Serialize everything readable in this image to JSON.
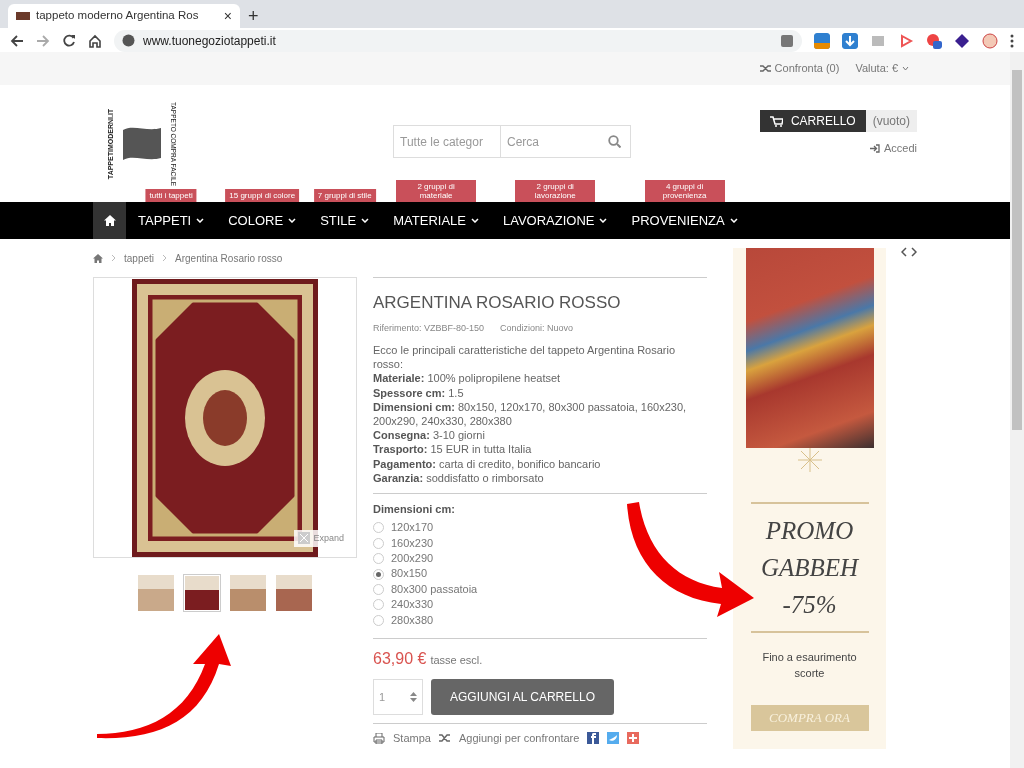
{
  "browser": {
    "tab_title": "tappeto moderno Argentina Ros",
    "tab_close": "×",
    "new_tab": "+",
    "url": "www.tuonegoziotappeti.it"
  },
  "top_bar": {
    "compare": "Confronta (0)",
    "currency": "Valuta: €"
  },
  "header": {
    "logo_text_top": "TAPPETIMODERNI.IT",
    "logo_text_side": "TAPPETO COMPRA FACILE",
    "category_select": "Tutte le categor",
    "search_placeholder": "Cerca",
    "cart_label": "CARRELLO",
    "cart_status": "(vuoto)",
    "login": "Accedi"
  },
  "menu": [
    {
      "label": "TAPPETI",
      "badge": "tutti i tappeti"
    },
    {
      "label": "COLORE",
      "badge": "15 gruppi di colore"
    },
    {
      "label": "STILE",
      "badge": "7 gruppi di stile"
    },
    {
      "label": "MATERIALE",
      "badge": "2 gruppi di materiale"
    },
    {
      "label": "LAVORAZIONE",
      "badge": "2 gruppi di lavorazione"
    },
    {
      "label": "PROVENIENZA",
      "badge": "4 gruppi di provenienza"
    }
  ],
  "breadcrumb": [
    "tappeti",
    "Argentina Rosario rosso"
  ],
  "gallery": {
    "expand": "Expand",
    "thumbnails": [
      {
        "selected": false
      },
      {
        "selected": true
      },
      {
        "selected": false
      },
      {
        "selected": false
      }
    ]
  },
  "product": {
    "title": "ARGENTINA ROSARIO ROSSO",
    "reference": "Riferimento: VZBBF-80-150",
    "condition": "Condizioni: Nuovo",
    "description": [
      "Ecco le principali caratteristiche del tappeto Argentina Rosario rosso:",
      "**Materiale:** 100% polipropilene heatset",
      "**Spessore cm:** 1.5",
      "**Dimensioni cm:** 80x150, 120x170, 80x300 passatoia, 160x230, 200x290, 240x330, 280x380",
      "**Consegna:** 3-10 giorni",
      "**Trasporto:** 15 EUR in tutta Italia",
      "**Pagamento:** carta di credito, bonifico bancario",
      "**Garanzia:** soddisfatto o rimborsato"
    ],
    "size_label": "Dimensioni cm:",
    "sizes": [
      {
        "label": "120x170",
        "selected": false
      },
      {
        "label": "160x230",
        "selected": false
      },
      {
        "label": "200x290",
        "selected": false
      },
      {
        "label": "80x150",
        "selected": true
      },
      {
        "label": "80x300 passatoia",
        "selected": false
      },
      {
        "label": "240x330",
        "selected": false
      },
      {
        "label": "280x380",
        "selected": false
      }
    ],
    "price": "63,90 €",
    "tax_note": "tasse escl.",
    "quantity": "1",
    "add_to_cart": "AGGIUNGI AL CARRELLO",
    "print": "Stampa",
    "compare": "Aggiungi per confrontare"
  },
  "promo": {
    "title": [
      "PROMO",
      "GABBEH",
      "-75%"
    ],
    "subtitle": "Fino a esaurimento scorte",
    "button": "COMPRA ORA"
  }
}
